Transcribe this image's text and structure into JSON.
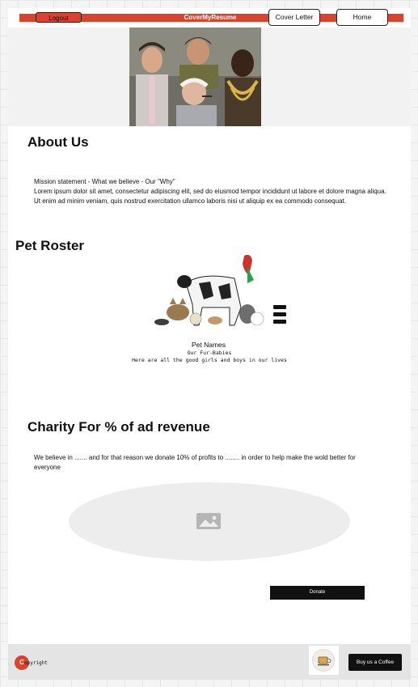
{
  "header": {
    "logout_label": "Logout",
    "brand": "CoverMyResume",
    "cover_letter_label": "Cover Letter",
    "home_label": "Home"
  },
  "about": {
    "title": "About Us",
    "mission_label": "Mission statement - What we believe - Our \"Why\"",
    "body": "Lorem ipsum dolor sit amet, consectetur adipiscing elit, sed do eiusmod tempor incididunt ut labore et dolore magna aliqua. Ut enim ad minim veniam, quis nostrud exercitation ullamco laboris nisi ut aliquip ex ea commodo consequat."
  },
  "roster": {
    "title": "Pet Roster",
    "pet_names": "Pet Names",
    "subtitle": "Our Fur-Babies",
    "description": "Here are all the good girls and boys in our lives"
  },
  "charity": {
    "title": "Charity For % of ad revenue",
    "body": "We believe in ....... and for that reason we donate 10% of profits to ........ in order to help make the wold better for everyone",
    "donate_label": "Donate"
  },
  "footer": {
    "copyright_badge": "C",
    "copyright_text": "opyright",
    "coffee_label": "Buy us a Coffee"
  },
  "icons": {
    "menu": "hamburger-menu-icon",
    "placeholder": "image-placeholder-icon",
    "coffee": "coffee-cup-icon"
  },
  "colors": {
    "accent_red": "#d9432f",
    "dark_button": "#111111",
    "footer_bg": "#e4e4e4"
  }
}
